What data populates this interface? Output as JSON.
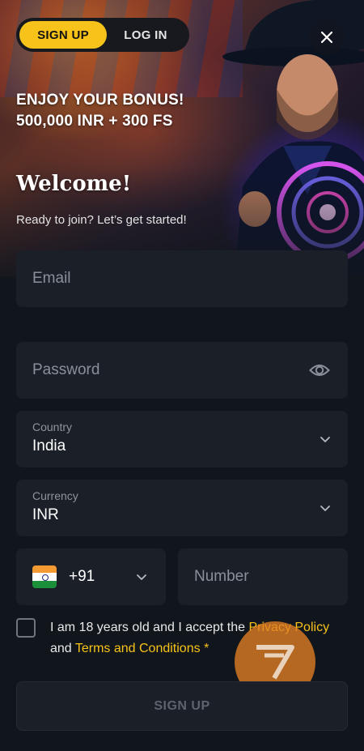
{
  "tabs": {
    "signup": "SIGN UP",
    "login": "LOG IN"
  },
  "hero": {
    "bonus_line1": "ENJOY YOUR BONUS!",
    "bonus_line2": "500,000 INR + 300 FS",
    "welcome": "Welcome!",
    "subtitle": "Ready to join? Let’s get started!"
  },
  "form": {
    "email_placeholder": "Email",
    "password_placeholder": "Password",
    "country_label": "Country",
    "country_value": "India",
    "currency_label": "Currency",
    "currency_value": "INR",
    "phone_code": "+91",
    "number_placeholder": "Number",
    "consent_prefix": "I am 18 years old and I accept the",
    "privacy_policy": "Privacy Policy",
    "and_word": "and",
    "terms": "Terms and Conditions",
    "required_mark": "*",
    "submit": "SIGN UP"
  },
  "icons": {
    "close": "close-icon",
    "password_visibility": "eye-icon",
    "dropdown": "chevron-down-icon",
    "flag": "india-flag-icon",
    "badge": "sevens-logo-badge"
  },
  "colors": {
    "accent": "#f7c21a",
    "background": "#11161c",
    "field": "#1b2028",
    "badge": "#e48022"
  }
}
